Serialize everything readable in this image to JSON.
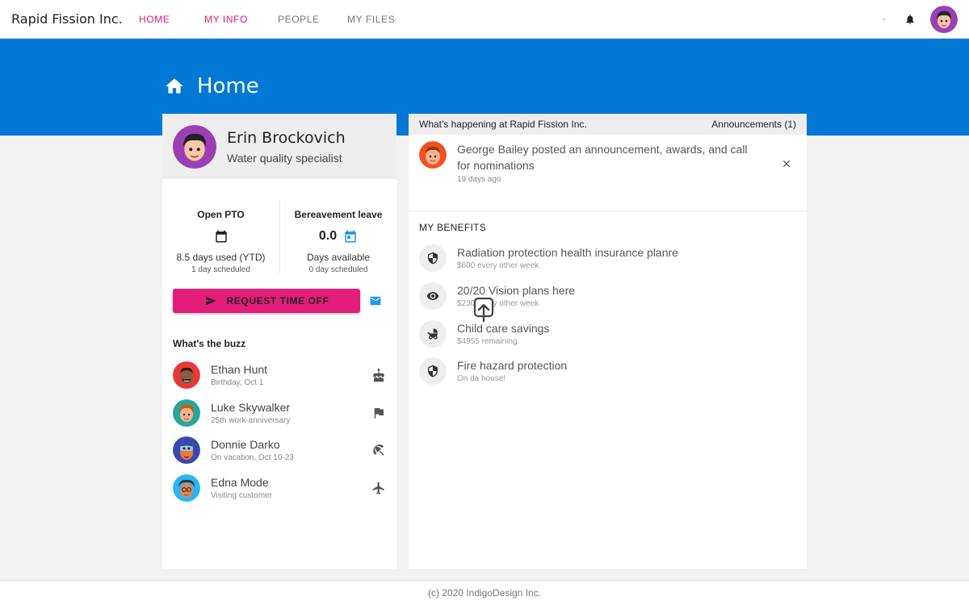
{
  "app": {
    "brand": "Rapid Fission Inc.",
    "nav": [
      {
        "label": "HOME",
        "active": true
      },
      {
        "label": "MY INFO",
        "active": false
      },
      {
        "label": "PEOPLE",
        "active": false
      },
      {
        "label": "MY FILES",
        "active": false
      }
    ]
  },
  "page": {
    "title": "Home"
  },
  "profile": {
    "name": "Erin Brockovich",
    "role": "Water quality specialist"
  },
  "pto": {
    "open": {
      "title": "Open PTO",
      "used": "8.5 days used (YTD)",
      "scheduled": "1 day scheduled"
    },
    "bereavement": {
      "title": "Bereavement leave",
      "value": "0.0",
      "available": "Days available",
      "scheduled": "0 day scheduled"
    }
  },
  "actions": {
    "request_time_off": "REQUEST TIME OFF"
  },
  "buzz": {
    "title": "What's the buzz",
    "items": [
      {
        "name": "Ethan Hunt",
        "sub": "Birthday, Oct 1",
        "icon": "cake-icon"
      },
      {
        "name": "Luke Skywalker",
        "sub": "25th work-anniversary",
        "icon": "flag-icon"
      },
      {
        "name": "Donnie Darko",
        "sub": "On vacation, Oct 10-23",
        "icon": "beach-umbrella-icon"
      },
      {
        "name": "Edna Mode",
        "sub": "Visiting customer",
        "icon": "airplane-icon"
      }
    ]
  },
  "news": {
    "header": "What's happening at Rapid Fission Inc.",
    "count_label": "Announcements (1)",
    "announcement": {
      "title": "George Bailey posted an announcement, awards, and call for nominations",
      "time": "19 days ago"
    }
  },
  "benefits": {
    "title": "MY BENEFITS",
    "items": [
      {
        "name": "Radiation protection health insurance planre",
        "sub": "$600 every other week",
        "icon": "shield-icon"
      },
      {
        "name": "20/20 Vision plans here",
        "sub": "$230 every other week",
        "icon": "eye-icon"
      },
      {
        "name": "Child care savings",
        "sub": "$4955 remaining",
        "icon": "stroller-icon"
      },
      {
        "name": "Fire hazard protection",
        "sub": "On da house!",
        "icon": "shield-icon"
      }
    ]
  },
  "footer": {
    "text": "(c) 2020 IndigoDesign Inc."
  },
  "colors": {
    "accent": "#e31c79",
    "primary": "#0078d4",
    "calendar_accent": "#2196f3"
  }
}
